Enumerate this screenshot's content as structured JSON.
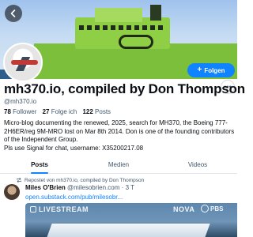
{
  "profile": {
    "display_name": "mh370.io, compiled by Don Thompson",
    "handle": "@mh370.io",
    "followers_count": "78",
    "followers_label": "Follower",
    "following_count": "27",
    "following_label": "Folge ich",
    "posts_count": "122",
    "posts_label": "Posts",
    "bio": "Micro-blog documenting the renewed, 2025, search for MH370, the Boeing 777-2H6ER/reg 9M-MRO lost on Mar 8th 2014. Don is one of the founding contributors of the Independent Group.\nPls use Signal for chat, username: X35200217.08"
  },
  "actions": {
    "follow_label": "Folgen",
    "follow_plus": "+",
    "more_label": "•••"
  },
  "tabs": [
    {
      "label": "Posts",
      "active": true
    },
    {
      "label": "Medien",
      "active": false
    },
    {
      "label": "Videos",
      "active": false
    }
  ],
  "feed": {
    "repost_label": "Repostet von mh370.io, compiled by Don Thompson",
    "post": {
      "author_name": "Miles O'Brien",
      "author_handle": "@milesobrien.com",
      "separator": "·",
      "age": "3 T",
      "link_text": "open.substack.com/pub/milesobr...",
      "media": {
        "live_label": "LIVESTREAM",
        "nova_label": "NOVA",
        "pbs_label": "PBS"
      }
    }
  },
  "colors": {
    "accent": "#1083fe",
    "text_primary": "#0b0f14",
    "text_secondary": "#42576c",
    "banner_green": "#7bbf3a"
  },
  "icons": {
    "back": "arrow-left-icon",
    "repost": "repost-icon",
    "more": "ellipsis-icon"
  }
}
